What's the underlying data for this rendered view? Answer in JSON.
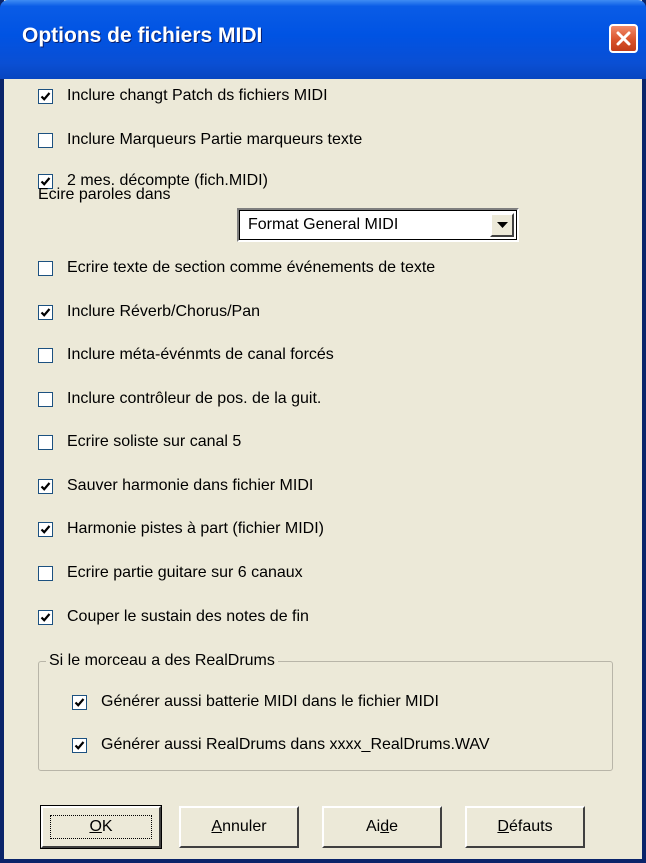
{
  "window": {
    "title": "Options de fichiers MIDI",
    "close_label": "✕"
  },
  "options": [
    {
      "label": "Inclure changt Patch ds fichiers MIDI",
      "checked": true
    },
    {
      "label": "Inclure Marqueurs Partie marqueurs texte",
      "checked": false
    },
    {
      "label": "2 mes. décompte (fich.MIDI)",
      "checked": true
    }
  ],
  "lyrics": {
    "label": "Ecire paroles dans",
    "value": "Format General MIDI"
  },
  "options2": [
    {
      "label": "Ecrire texte de section comme événements de texte",
      "checked": false
    },
    {
      "label": "Inclure Réverb/Chorus/Pan",
      "checked": true
    },
    {
      "label": "Inclure méta-événmts de canal forcés",
      "checked": false
    },
    {
      "label": "Inclure contrôleur de pos. de la guit.",
      "checked": false
    },
    {
      "label": "Ecrire soliste sur canal 5",
      "checked": false
    },
    {
      "label": "Sauver harmonie dans fichier MIDI",
      "checked": true
    },
    {
      "label": "Harmonie pistes à part (fichier MIDI)",
      "checked": true
    },
    {
      "label": "Ecrire partie guitare sur 6 canaux",
      "checked": false
    },
    {
      "label": "Couper le sustain des notes de fin",
      "checked": true
    }
  ],
  "realdrums": {
    "title": "Si le morceau a des RealDrums",
    "options": [
      {
        "label": "Générer aussi batterie MIDI dans le fichier MIDI",
        "checked": true
      },
      {
        "label": "Générer aussi RealDrums dans xxxx_RealDrums.WAV",
        "checked": true
      }
    ]
  },
  "buttons": {
    "ok": {
      "mnemonic": "O",
      "rest": "K"
    },
    "cancel": {
      "mnemonic": "A",
      "rest": "nnuler"
    },
    "help": {
      "pre": "Ai",
      "mnemonic": "d",
      "post": "e"
    },
    "defaults": {
      "mnemonic": "D",
      "rest": "éfauts"
    }
  }
}
